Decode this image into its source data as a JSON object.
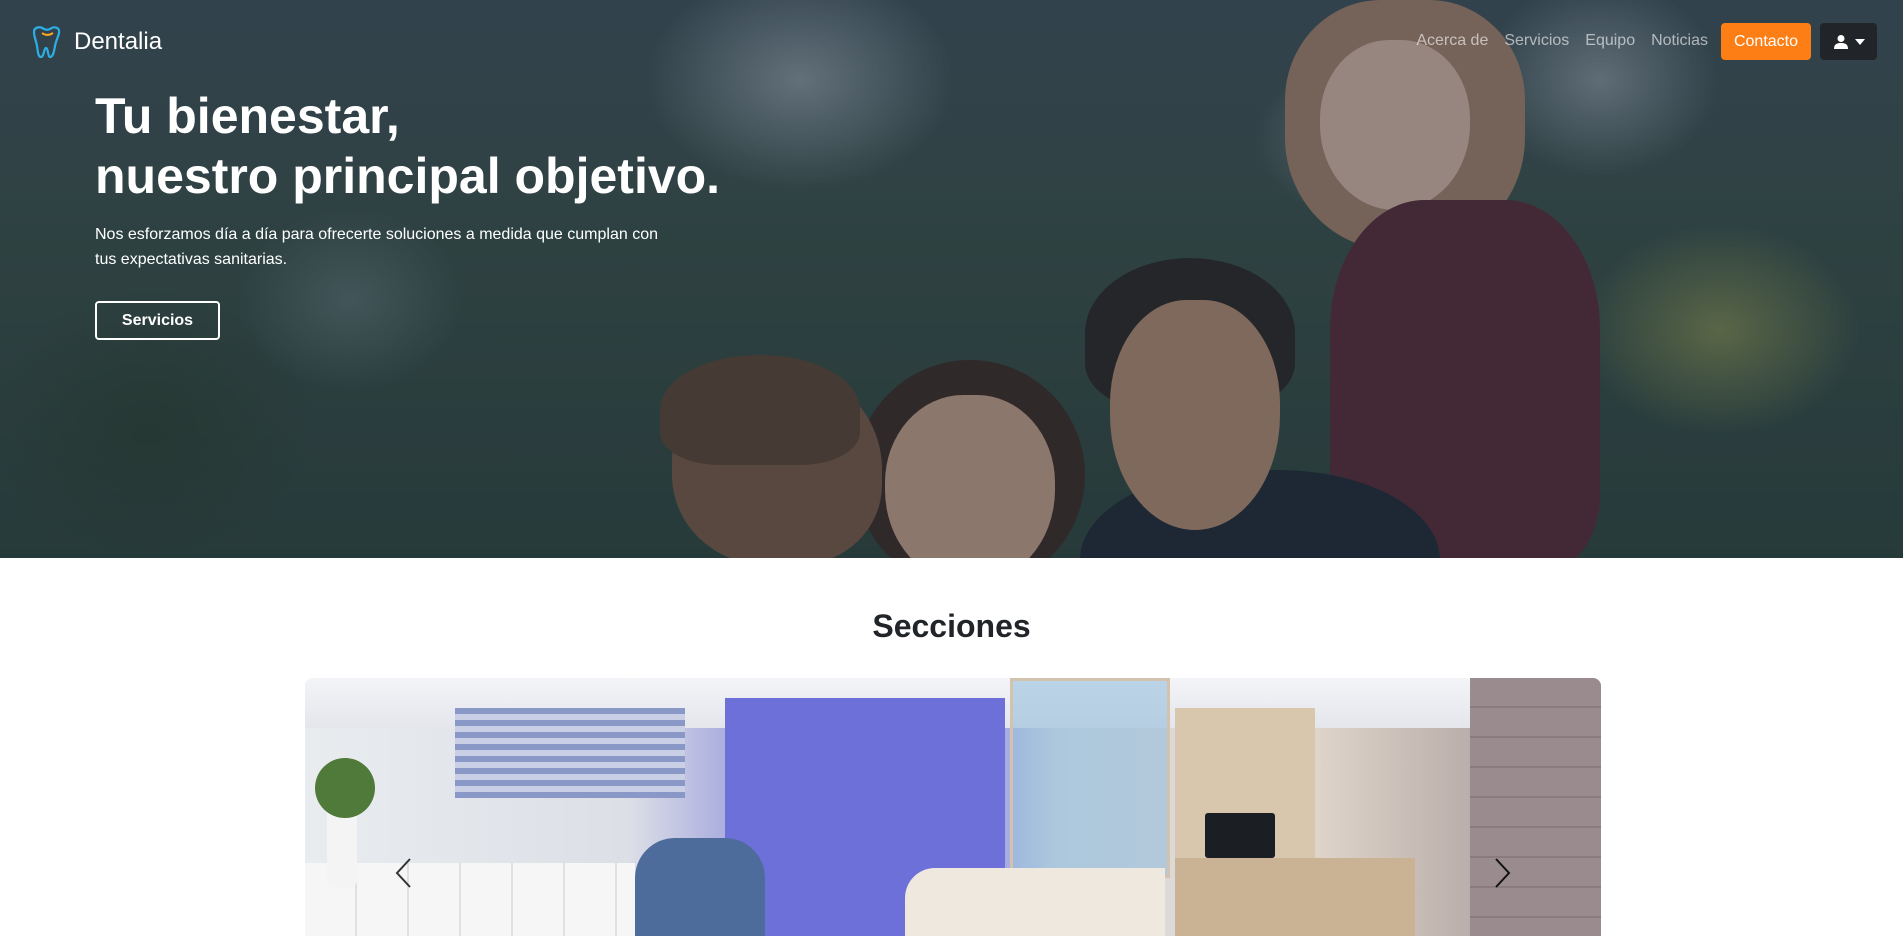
{
  "navbar": {
    "brand": "Dentalia",
    "links": [
      "Acerca de",
      "Servicios",
      "Equipo",
      "Noticias"
    ],
    "contact_label": "Contacto",
    "colors": {
      "accent": "#fd7e14",
      "user_button": "#212529"
    }
  },
  "hero": {
    "title_line1": "Tu bienestar,",
    "title_line2": "nuestro principal objetivo.",
    "subtitle": "Nos esforzamos día a día para ofrecerte soluciones a medida que cumplan con tus expectativas sanitarias.",
    "cta_label": "Servicios"
  },
  "sections": {
    "title": "Secciones"
  }
}
